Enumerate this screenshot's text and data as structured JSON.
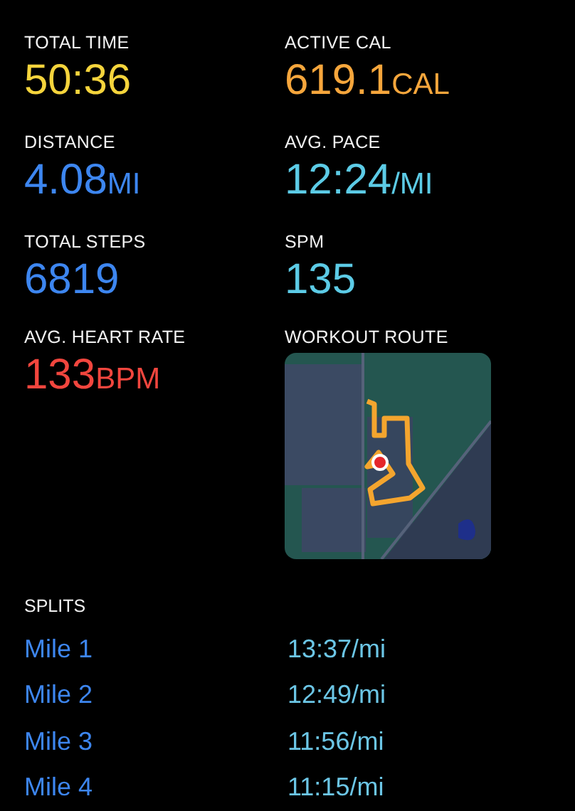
{
  "metrics": [
    {
      "kind": "value",
      "label": "TOTAL TIME",
      "value": "50:36",
      "color": "#f5d43c"
    },
    {
      "kind": "value",
      "label": "ACTIVE CAL",
      "value": "619.1",
      "unit": "CAL",
      "color": "#f6a63c"
    },
    {
      "kind": "value",
      "label": "DISTANCE",
      "value": "4.08",
      "unit": "MI",
      "color": "#3d86f0"
    },
    {
      "kind": "value",
      "label": "AVG. PACE",
      "value": "12:24",
      "unit": "/MI",
      "color": "#5ccbe6"
    },
    {
      "kind": "value",
      "label": "TOTAL STEPS",
      "value": "6819",
      "color": "#3d86f0"
    },
    {
      "kind": "value",
      "label": "SPM",
      "value": "135",
      "color": "#5ccbe6"
    },
    {
      "kind": "value",
      "label": "AVG. HEART RATE",
      "value": "133",
      "unit": "BPM",
      "color": "#f2463e"
    },
    {
      "kind": "map",
      "label": "WORKOUT ROUTE"
    }
  ],
  "splits": {
    "title": "SPLITS",
    "rows": [
      {
        "name": "Mile 1",
        "pace": "13:37/mi"
      },
      {
        "name": "Mile 2",
        "pace": "12:49/mi"
      },
      {
        "name": "Mile 3",
        "pace": "11:56/mi"
      },
      {
        "name": "Mile 4",
        "pace": "11:15/mi"
      }
    ]
  }
}
